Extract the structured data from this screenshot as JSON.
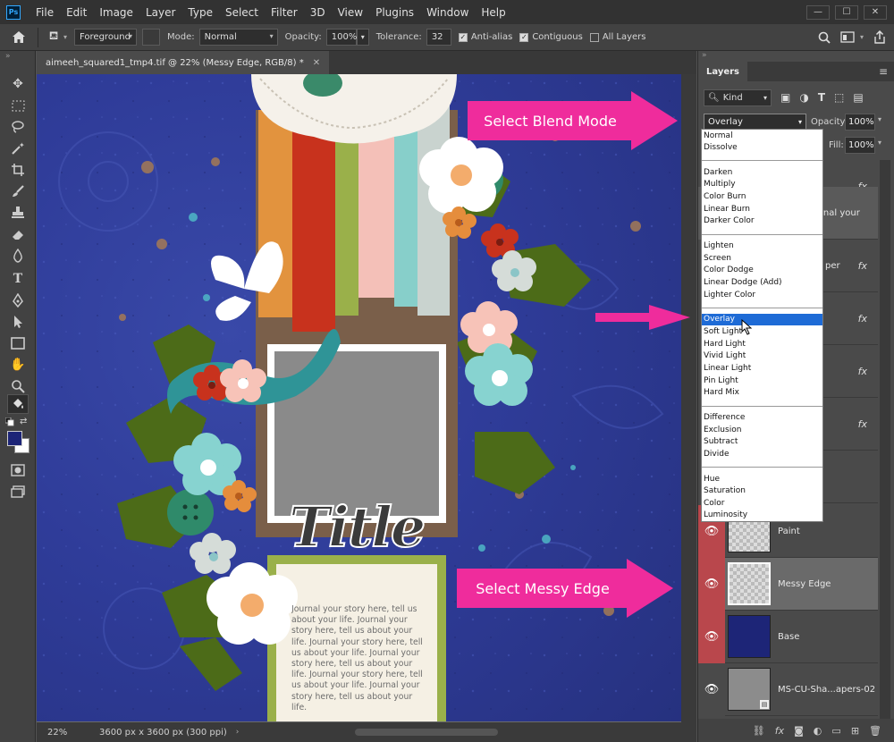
{
  "menubar": {
    "logo": "Ps",
    "items": [
      "File",
      "Edit",
      "Image",
      "Layer",
      "Type",
      "Select",
      "Filter",
      "3D",
      "View",
      "Plugins",
      "Window",
      "Help"
    ],
    "window_controls": [
      "—",
      "☐",
      "✕"
    ]
  },
  "options_bar": {
    "fill_source": "Foreground",
    "mode_label": "Mode:",
    "mode_value": "Normal",
    "opacity_label": "Opacity:",
    "opacity_value": "100%",
    "tolerance_label": "Tolerance:",
    "tolerance_value": "32",
    "antialias_label": "Anti-alias",
    "contiguous_label": "Contiguous",
    "all_layers_label": "All Layers"
  },
  "document_tab": {
    "title": "aimeeh_squared1_tmp4.tif @ 22% (Messy Edge, RGB/8) *",
    "close": "✕"
  },
  "status_bar": {
    "zoom": "22%",
    "doc_size": "3600 px x 3600 px (300 ppi)"
  },
  "canvas_art": {
    "title_text": "Title",
    "journal_text": "Journal your story here, tell us about your life. Journal your story here, tell us about your life. Journal your story here, tell us about your life. Journal your story here, tell us about your life. Journal your story here, tell us about your life. Journal your story here, tell us about your life."
  },
  "layers_panel": {
    "tab_label": "Layers",
    "kind_label": "Kind",
    "blend_value": "Overlay",
    "opacity_label": "Opacity:",
    "opacity_value": "100%",
    "fill_label": "Fill:",
    "fill_value": "100%",
    "partial_layer_text_1": "rnal your",
    "partial_layer_text_2": "per",
    "layers": [
      {
        "name": "Paint"
      },
      {
        "name": "Messy Edge"
      },
      {
        "name": "Base"
      },
      {
        "name": "MS-CU-Sha...apers-02"
      }
    ]
  },
  "blend_modes": [
    [
      "Normal",
      "Dissolve"
    ],
    [
      "Darken",
      "Multiply",
      "Color Burn",
      "Linear Burn",
      "Darker Color"
    ],
    [
      "Lighten",
      "Screen",
      "Color Dodge",
      "Linear Dodge (Add)",
      "Lighter Color"
    ],
    [
      "Overlay",
      "Soft Light",
      "Hard Light",
      "Vivid Light",
      "Linear Light",
      "Pin Light",
      "Hard Mix"
    ],
    [
      "Difference",
      "Exclusion",
      "Subtract",
      "Divide"
    ],
    [
      "Hue",
      "Saturation",
      "Color",
      "Luminosity"
    ]
  ],
  "annotations": {
    "blend_callout": "Select Blend Mode",
    "layer_callout": "Select Messy Edge"
  },
  "colors": {
    "accent_pink": "#ef2c9c",
    "selection_blue": "#1e6bd6",
    "layer_red": "#b9474c",
    "foreground_swatch": "#1d2577"
  }
}
